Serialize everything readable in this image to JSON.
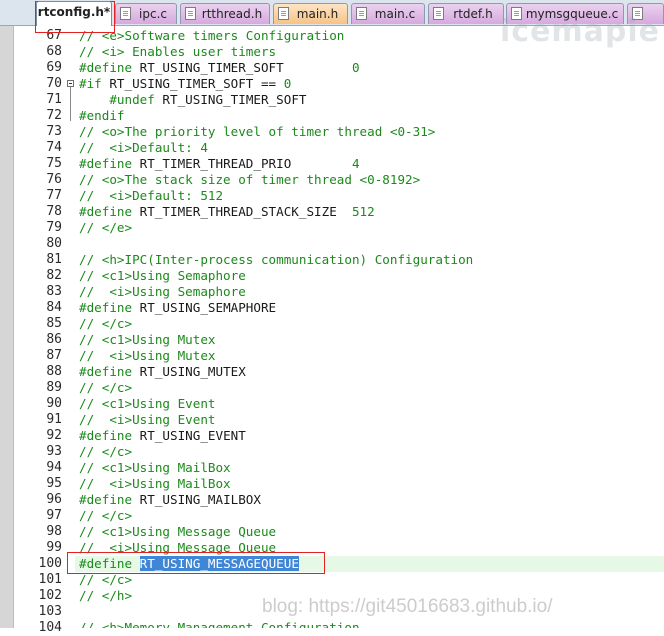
{
  "tabs": [
    {
      "label": "rtconfig.h*",
      "style": "active"
    },
    {
      "label": "ipc.c",
      "style": "purple"
    },
    {
      "label": "rtthread.h",
      "style": "purple"
    },
    {
      "label": "main.h",
      "style": "orange"
    },
    {
      "label": "main.c",
      "style": "purple"
    },
    {
      "label": "rtdef.h",
      "style": "purple"
    },
    {
      "label": "mymsgqueue.c",
      "style": "purple"
    },
    {
      "label": "",
      "style": "purple"
    }
  ],
  "editor": {
    "lines": [
      {
        "n": "67",
        "html": "<span class=\"c\">// &lt;e&gt;Software timers Configuration</span>"
      },
      {
        "n": "68",
        "html": "<span class=\"c\">// &lt;i&gt; Enables user timers</span>"
      },
      {
        "n": "69",
        "html": "<span class=\"d\">#define</span> RT_USING_TIMER_SOFT         <span class=\"num\">0</span>"
      },
      {
        "n": "70",
        "html": "<span class=\"d\">#if</span> RT_USING_TIMER_SOFT == <span class=\"num\">0</span>"
      },
      {
        "n": "71",
        "html": "    <span class=\"d\">#undef</span> RT_USING_TIMER_SOFT"
      },
      {
        "n": "72",
        "html": "<span class=\"d\">#endif</span>"
      },
      {
        "n": "73",
        "html": "<span class=\"c\">// &lt;o&gt;The priority level of timer thread &lt;0-31&gt;</span>"
      },
      {
        "n": "74",
        "html": "<span class=\"c\">//  &lt;i&gt;Default: 4</span>"
      },
      {
        "n": "75",
        "html": "<span class=\"d\">#define</span> RT_TIMER_THREAD_PRIO        <span class=\"num\">4</span>"
      },
      {
        "n": "76",
        "html": "<span class=\"c\">// &lt;o&gt;The stack size of timer thread &lt;0-8192&gt;</span>"
      },
      {
        "n": "77",
        "html": "<span class=\"c\">//  &lt;i&gt;Default: 512</span>"
      },
      {
        "n": "78",
        "html": "<span class=\"d\">#define</span> RT_TIMER_THREAD_STACK_SIZE  <span class=\"num\">512</span>"
      },
      {
        "n": "79",
        "html": "<span class=\"c\">// &lt;/e&gt;</span>"
      },
      {
        "n": "80",
        "html": ""
      },
      {
        "n": "81",
        "html": "<span class=\"c\">// &lt;h&gt;IPC(Inter-process communication) Configuration</span>"
      },
      {
        "n": "82",
        "html": "<span class=\"c\">// &lt;c1&gt;Using Semaphore</span>"
      },
      {
        "n": "83",
        "html": "<span class=\"c\">//  &lt;i&gt;Using Semaphore</span>"
      },
      {
        "n": "84",
        "html": "<span class=\"d\">#define</span> RT_USING_SEMAPHORE"
      },
      {
        "n": "85",
        "html": "<span class=\"c\">// &lt;/c&gt;</span>"
      },
      {
        "n": "86",
        "html": "<span class=\"c\">// &lt;c1&gt;Using Mutex</span>"
      },
      {
        "n": "87",
        "html": "<span class=\"c\">//  &lt;i&gt;Using Mutex</span>"
      },
      {
        "n": "88",
        "html": "<span class=\"d\">#define</span> RT_USING_MUTEX"
      },
      {
        "n": "89",
        "html": "<span class=\"c\">// &lt;/c&gt;</span>"
      },
      {
        "n": "90",
        "html": "<span class=\"c\">// &lt;c1&gt;Using Event</span>"
      },
      {
        "n": "91",
        "html": "<span class=\"c\">//  &lt;i&gt;Using Event</span>"
      },
      {
        "n": "92",
        "html": "<span class=\"d\">#define</span> RT_USING_EVENT"
      },
      {
        "n": "93",
        "html": "<span class=\"c\">// &lt;/c&gt;</span>"
      },
      {
        "n": "94",
        "html": "<span class=\"c\">// &lt;c1&gt;Using MailBox</span>"
      },
      {
        "n": "95",
        "html": "<span class=\"c\">//  &lt;i&gt;Using MailBox</span>"
      },
      {
        "n": "96",
        "html": "<span class=\"d\">#define</span> RT_USING_MAILBOX"
      },
      {
        "n": "97",
        "html": "<span class=\"c\">// &lt;/c&gt;</span>"
      },
      {
        "n": "98",
        "html": "<span class=\"c\">// &lt;c1&gt;Using Message Queue</span>"
      },
      {
        "n": "99",
        "html": "<span class=\"c\">//  &lt;i&gt;Using Message Queue</span>"
      },
      {
        "n": "100",
        "html": "<span class=\"d\">#define</span> <span class=\"sel\">RT_USING_MESSAGEQUEUE</span>",
        "current": true
      },
      {
        "n": "101",
        "html": "<span class=\"c\">// &lt;/c&gt;</span>"
      },
      {
        "n": "102",
        "html": "<span class=\"c\">// &lt;/h&gt;</span>"
      },
      {
        "n": "103",
        "html": ""
      },
      {
        "n": "104",
        "html": "<span class=\"c\">// &lt;h&gt;Memory Management Configuration</span>"
      }
    ]
  },
  "watermark": "blog: https://git45016683.github.io/",
  "logo_text": "icemapie",
  "left_logo_text": "一一一一"
}
